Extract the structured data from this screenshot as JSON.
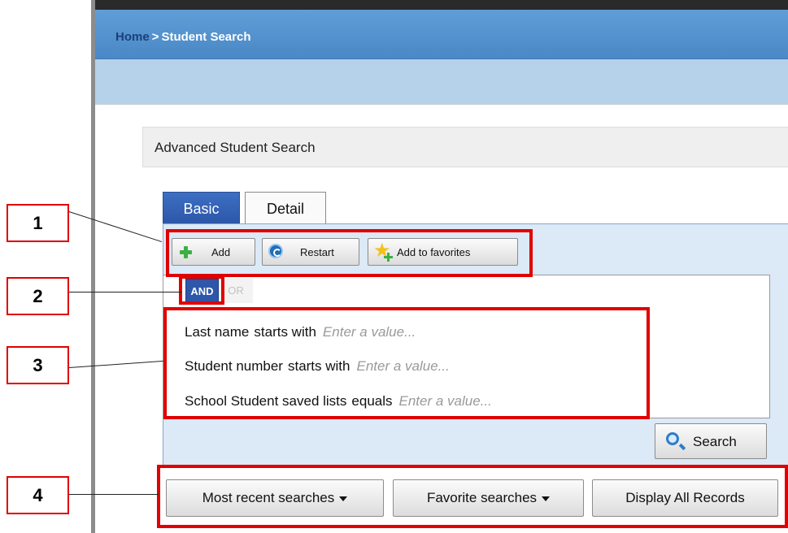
{
  "breadcrumb": {
    "home": "Home",
    "separator": ">",
    "current": "Student Search"
  },
  "panel": {
    "title": "Advanced Student Search"
  },
  "tabs": [
    {
      "label": "Basic",
      "active": true
    },
    {
      "label": "Detail",
      "active": false
    }
  ],
  "toolbar": {
    "add_label": "Add",
    "restart_label": "Restart",
    "favorites_label": "Add to favorites"
  },
  "logic": {
    "and_label": "AND",
    "or_label": "OR",
    "selected": "AND"
  },
  "criteria": [
    {
      "field": "Last name",
      "operator": "starts with",
      "placeholder": "Enter a value..."
    },
    {
      "field": "Student number",
      "operator": "starts with",
      "placeholder": "Enter a value..."
    },
    {
      "field": "School Student saved lists",
      "operator": "equals",
      "placeholder": "Enter a value..."
    }
  ],
  "search_button": "Search",
  "bottom_buttons": {
    "recent": "Most recent searches",
    "favorites": "Favorite searches",
    "display_all": "Display All Records"
  },
  "annotations": [
    "1",
    "2",
    "3",
    "4"
  ],
  "colors": {
    "header": "#4a88c6",
    "tab_active": "#2c56a8",
    "highlight": "#e00000"
  }
}
